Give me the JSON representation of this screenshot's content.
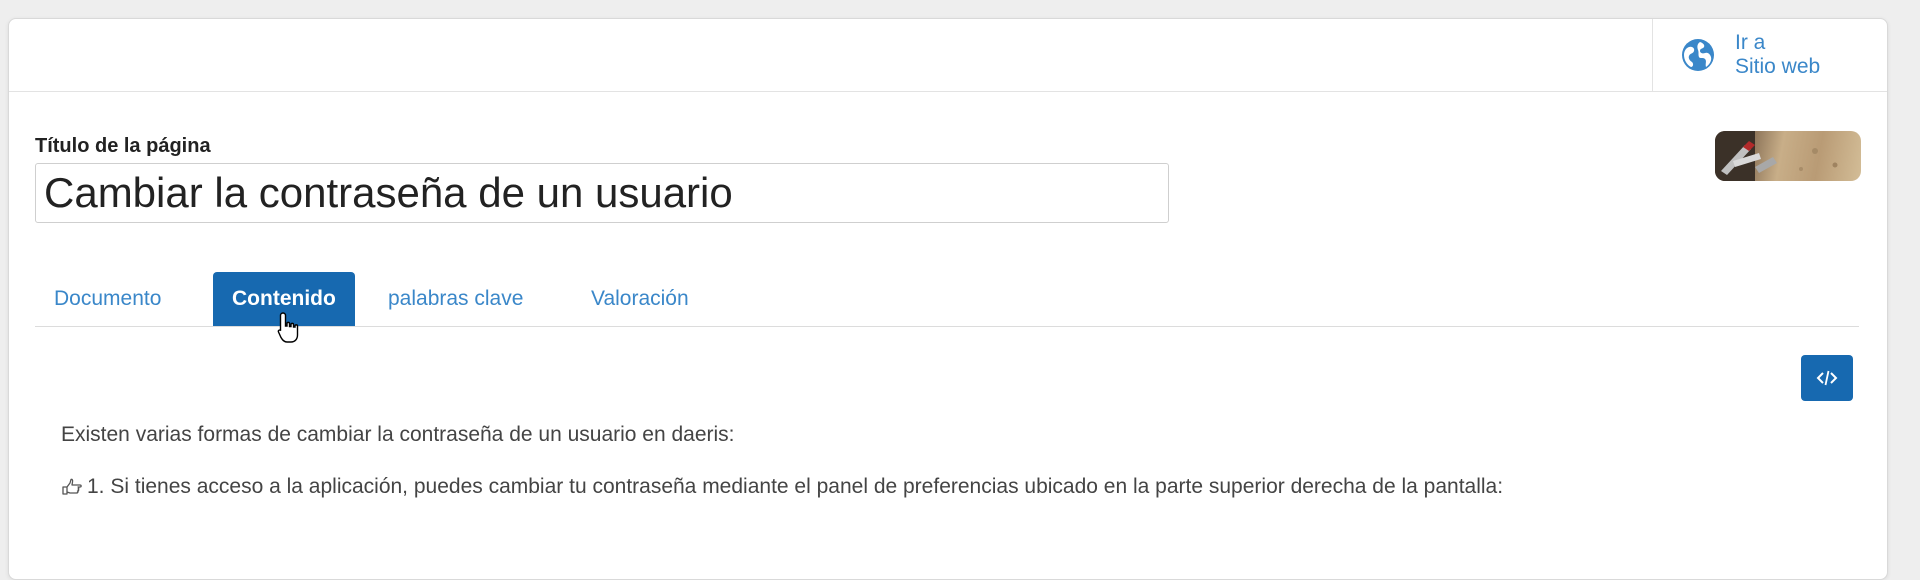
{
  "header": {
    "goto_site_line1": "Ir a",
    "goto_site_line2": "Sitio web"
  },
  "page": {
    "title_label": "Título de la página",
    "title_value": "Cambiar la contraseña de un usuario"
  },
  "tabs": [
    {
      "label": "Documento",
      "active": false
    },
    {
      "label": "Contenido",
      "active": true
    },
    {
      "label": "palabras clave",
      "active": false
    },
    {
      "label": "Valoración",
      "active": false
    }
  ],
  "content": {
    "intro": "Existen varias formas de cambiar la contraseña de un usuario en daeris:",
    "item1": "1. Si tienes acceso a la aplicación, puedes cambiar tu contraseña mediante el panel de preferencias ubicado en la parte superior derecha de la pantalla:"
  },
  "icons": {
    "globe": "globe-icon",
    "code": "code-icon",
    "hand": "pointing-hand-icon",
    "cursor": "hand-cursor-icon"
  },
  "colors": {
    "accent": "#1769b0",
    "link": "#3a87c9"
  }
}
